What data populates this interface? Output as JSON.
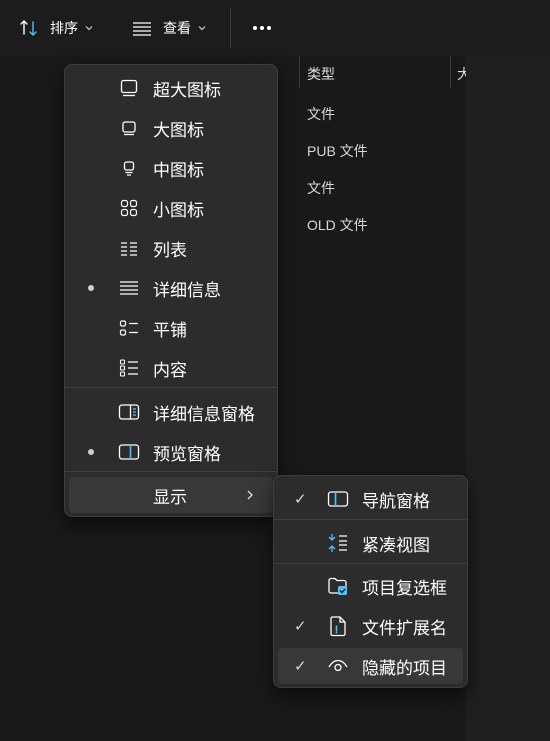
{
  "toolbar": {
    "sort_label": "排序",
    "view_label": "查看"
  },
  "columns": {
    "type_header": "类型",
    "next_header_partial": "大"
  },
  "file_types": [
    "文件",
    "PUB 文件",
    "文件",
    "OLD 文件"
  ],
  "view_menu": {
    "items": [
      {
        "label": "超大图标",
        "icon": "extra-large-icons-icon",
        "selected": false
      },
      {
        "label": "大图标",
        "icon": "large-icons-icon",
        "selected": false
      },
      {
        "label": "中图标",
        "icon": "medium-icons-icon",
        "selected": false
      },
      {
        "label": "小图标",
        "icon": "small-icons-icon",
        "selected": false
      },
      {
        "label": "列表",
        "icon": "list-icon",
        "selected": false
      },
      {
        "label": "详细信息",
        "icon": "details-icon",
        "selected": true
      },
      {
        "label": "平铺",
        "icon": "tiles-icon",
        "selected": false
      },
      {
        "label": "内容",
        "icon": "content-icon",
        "selected": false
      },
      {
        "label": "详细信息窗格",
        "icon": "details-pane-icon",
        "selected": false
      },
      {
        "label": "预览窗格",
        "icon": "preview-pane-icon",
        "selected": true
      }
    ],
    "show_label": "显示"
  },
  "show_submenu": {
    "items": [
      {
        "label": "导航窗格",
        "icon": "navigation-pane-icon",
        "checked": true
      },
      {
        "label": "紧凑视图",
        "icon": "compact-view-icon",
        "checked": false
      },
      {
        "label": "项目复选框",
        "icon": "item-checkbox-icon",
        "checked": false
      },
      {
        "label": "文件扩展名",
        "icon": "file-extension-icon",
        "checked": true
      },
      {
        "label": "隐藏的项目",
        "icon": "hidden-items-icon",
        "checked": true
      }
    ],
    "check_glyph": "✓"
  },
  "colors": {
    "accent": "#4cc2ff",
    "menu_bg": "#2c2c2c",
    "page_bg": "#191919"
  }
}
